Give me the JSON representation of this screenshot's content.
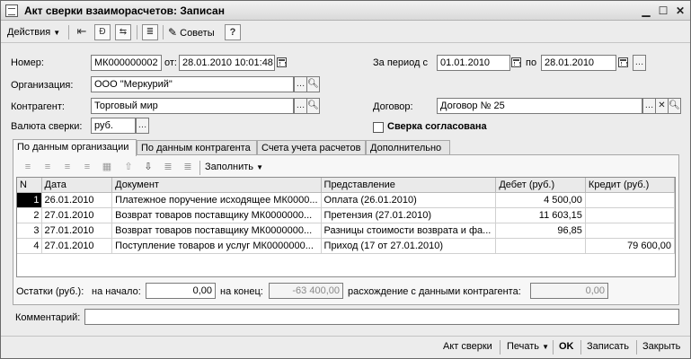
{
  "window": {
    "title": "Акт сверки взаиморасчетов: Записан"
  },
  "toolbar": {
    "actions_label": "Действия",
    "tips_label": "Советы",
    "help_label": "?"
  },
  "form": {
    "number_label": "Номер:",
    "number_value": "МК000000002",
    "from_label": "от:",
    "from_value": "28.01.2010 10:01:48",
    "period_label": "За период с",
    "period_start": "01.01.2010",
    "period_to_label": "по",
    "period_end": "28.01.2010",
    "org_label": "Организация:",
    "org_value": "ООО \"Меркурий\"",
    "contractor_label": "Контрагент:",
    "contractor_value": "Торговый мир",
    "contract_label": "Договор:",
    "contract_value": "Договор № 25",
    "currency_label": "Валюта сверки:",
    "currency_value": "руб.",
    "agreed_label": "Сверка согласована"
  },
  "tabs": [
    "По данным организации",
    "По данным контрагента",
    "Счета учета расчетов",
    "Дополнительно"
  ],
  "table_toolbar": {
    "fill_label": "Заполнить"
  },
  "table": {
    "columns": [
      "N",
      "Дата",
      "Документ",
      "Представление",
      "Дебет (руб.)",
      "Кредит (руб.)"
    ],
    "rows": [
      [
        "1",
        "26.01.2010",
        "Платежное поручение исходящее МК0000...",
        "Оплата (26.01.2010)",
        "4 500,00",
        ""
      ],
      [
        "2",
        "27.01.2010",
        "Возврат товаров поставщику МК0000000...",
        "Претензия (27.01.2010)",
        "11 603,15",
        ""
      ],
      [
        "3",
        "27.01.2010",
        "Возврат товаров поставщику МК0000000...",
        "Разницы стоимости возврата и фа...",
        "96,85",
        ""
      ],
      [
        "4",
        "27.01.2010",
        "Поступление товаров и услуг МК0000000...",
        "Приход (17 от 27.01.2010)",
        "",
        "79 600,00"
      ]
    ]
  },
  "balances": {
    "label": "Остатки (руб.):",
    "start_label": "на начало:",
    "start_value": "0,00",
    "end_label": "на конец:",
    "end_value": "-63 400,00",
    "diff_label": "расхождение с данными контрагента:",
    "diff_value": "0,00"
  },
  "comment": {
    "label": "Комментарий:",
    "value": ""
  },
  "bottom": {
    "act_label": "Акт сверки",
    "print_label": "Печать",
    "ok_label": "OK",
    "save_label": "Записать",
    "close_label": "Закрыть"
  }
}
